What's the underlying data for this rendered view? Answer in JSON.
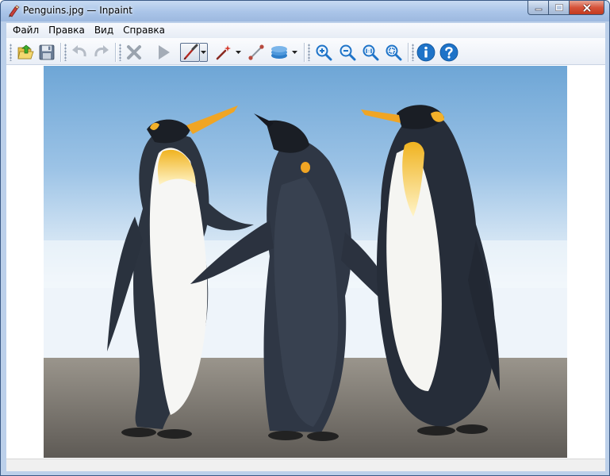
{
  "window": {
    "title": "Penguins.jpg — Inpaint",
    "app_icon": "inpaint-app-icon",
    "caption_buttons": [
      "minimize-icon",
      "maximize-icon",
      "close-icon"
    ]
  },
  "menu": {
    "items": [
      {
        "label": "Файл"
      },
      {
        "label": "Правка"
      },
      {
        "label": "Вид"
      },
      {
        "label": "Справка"
      }
    ]
  },
  "toolbar": {
    "buttons": [
      {
        "name": "open-button",
        "icon": "open-folder-icon"
      },
      {
        "name": "save-button",
        "icon": "save-disk-icon"
      },
      {
        "name": "undo-button",
        "icon": "undo-arrow-icon",
        "enabled": false
      },
      {
        "name": "redo-button",
        "icon": "redo-arrow-icon",
        "enabled": false
      },
      {
        "name": "erase-selection-button",
        "icon": "x-cross-icon",
        "enabled": false
      },
      {
        "name": "run-inpaint-button",
        "icon": "play-icon",
        "enabled": false
      },
      {
        "name": "marker-tool-button",
        "icon": "marker-pen-icon",
        "active": true
      },
      {
        "name": "magic-wand-button",
        "icon": "magic-wand-icon"
      },
      {
        "name": "line-tool-button",
        "icon": "line-segment-icon"
      },
      {
        "name": "layers-button",
        "icon": "layers-stack-icon"
      },
      {
        "name": "zoom-in-button",
        "icon": "zoom-in-icon"
      },
      {
        "name": "zoom-out-button",
        "icon": "zoom-out-icon"
      },
      {
        "name": "zoom-actual-button",
        "icon": "zoom-1to1-icon"
      },
      {
        "name": "zoom-fit-button",
        "icon": "zoom-fit-icon"
      },
      {
        "name": "info-button",
        "icon": "info-icon"
      },
      {
        "name": "help-button",
        "icon": "help-icon"
      }
    ],
    "accent_color": "#1e73c8"
  },
  "canvas": {
    "image": "penguins-photo",
    "sky_color": "#7fb0d9",
    "sand_color": "#8f8a82"
  },
  "statusbar": {
    "text": ""
  }
}
